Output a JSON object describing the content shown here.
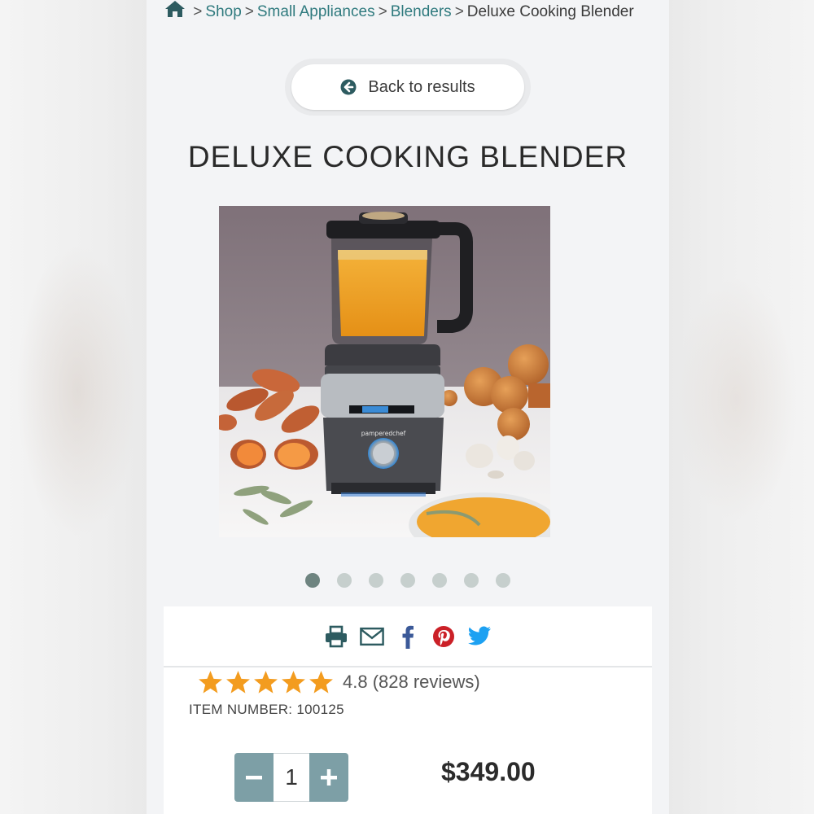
{
  "breadcrumb": {
    "home_icon": "home-icon",
    "items": [
      "Shop",
      "Small Appliances",
      "Blenders"
    ],
    "current": "Deluxe Cooking Blender",
    "separator": ">"
  },
  "back_button": {
    "label": "Back to results",
    "icon": "arrow-circle-left-icon"
  },
  "product": {
    "title": "DELUXE COOKING BLENDER",
    "image_alt": "Deluxe Cooking Blender with butternut soup, sweet potatoes, onions and garlic",
    "brand_on_image": "pamperedchef",
    "carousel": {
      "count": 7,
      "active_index": 0
    }
  },
  "share": {
    "icons": [
      "print-icon",
      "email-icon",
      "facebook-icon",
      "pinterest-icon",
      "twitter-icon"
    ]
  },
  "rating": {
    "stars": 5,
    "text": "4.8 (828 reviews)"
  },
  "item_number": "ITEM NUMBER: 100125",
  "quantity": {
    "value": "1",
    "minus": "−",
    "plus": "+"
  },
  "price": "$349.00",
  "colors": {
    "link": "#2f7a7e",
    "star": "#f39c1f",
    "qty_button": "#7d9fa6",
    "facebook": "#3b5998",
    "pinterest": "#cb2027",
    "twitter": "#1da1f2",
    "icon_dark": "#2d5b60"
  }
}
